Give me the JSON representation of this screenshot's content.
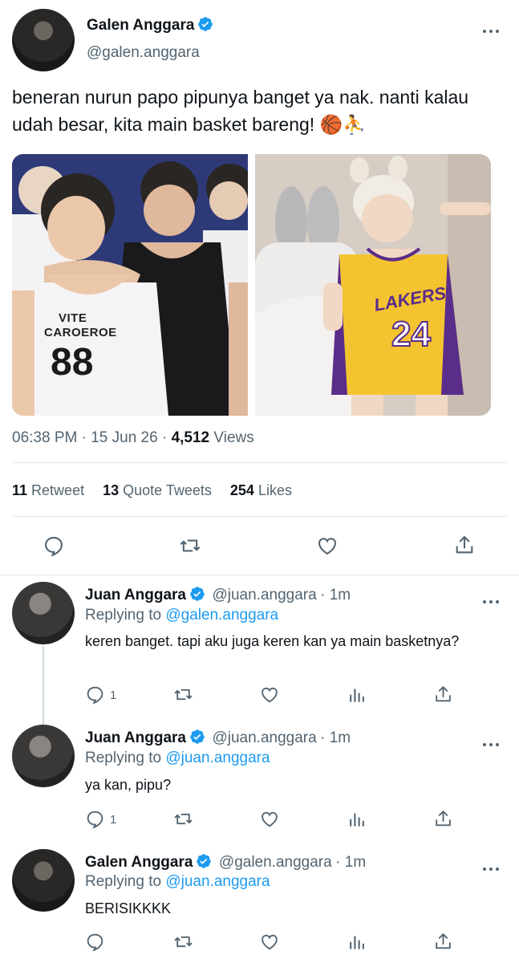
{
  "main_tweet": {
    "author_name": "Galen Anggara",
    "author_handle": "@galen.anggara",
    "text": "beneran nurun papo pipunya banget ya nak. nanti kalau udah besar, kita main basket bareng! 🏀⛹",
    "time": "06:38 PM",
    "sep1": "·",
    "date": "15 Jun 26",
    "sep2": "·",
    "views_count": "4,512",
    "views_label": "Views",
    "photo_left": {
      "jersey_text_top": "VITE",
      "jersey_text": "CAROEROE",
      "jersey_number": "88"
    },
    "photo_right": {
      "jersey_text": "LAKERS",
      "jersey_number": "24"
    },
    "stats": {
      "retweets_count": "11",
      "retweets_label": "Retweet",
      "quotes_count": "13",
      "quotes_label": "Quote Tweets",
      "likes_count": "254",
      "likes_label": "Likes"
    }
  },
  "replies": [
    {
      "author_name": "Juan Anggara",
      "author_handle": "@juan.anggara",
      "time": "· 1m",
      "replying_prefix": "Replying to",
      "replying_to": "@galen.anggara",
      "text": "keren banget. tapi aku juga keren kan ya main basketnya?",
      "reply_count": "1"
    },
    {
      "author_name": "Juan Anggara",
      "author_handle": "@juan.anggara",
      "time": "· 1m",
      "replying_prefix": "Replying to",
      "replying_to": "@juan.anggara",
      "text": "ya kan, pipu?",
      "reply_count": "1"
    },
    {
      "author_name": "Galen Anggara",
      "author_handle": "@galen.anggara",
      "time": "· 1m",
      "replying_prefix": "Replying to",
      "replying_to": "@juan.anggara",
      "text": "BERISIKKKK",
      "reply_count": ""
    }
  ],
  "colors": {
    "accent": "#1d9bf0",
    "text": "#0f1419",
    "muted": "#536471",
    "divider": "#e6e9ec"
  },
  "icons": [
    "verified-badge-icon",
    "more-icon",
    "reply-icon",
    "retweet-icon",
    "like-icon",
    "share-icon",
    "analytics-icon"
  ]
}
